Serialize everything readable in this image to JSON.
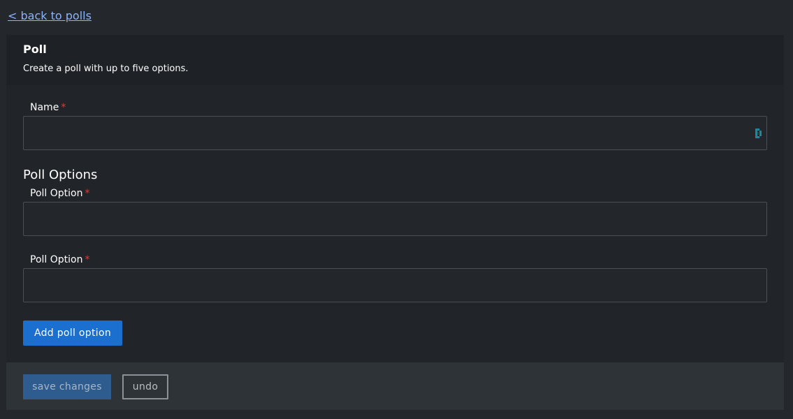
{
  "nav": {
    "back_link": "< back to polls"
  },
  "card": {
    "title": "Poll",
    "subtitle": "Create a poll with up to five options."
  },
  "form": {
    "name_label": "Name",
    "name_value": "",
    "required_marker": "*",
    "options_heading": "Poll Options",
    "options": [
      {
        "label": "Poll Option",
        "value": ""
      },
      {
        "label": "Poll Option",
        "value": ""
      }
    ],
    "add_option_label": "Add poll option"
  },
  "footer": {
    "save_label": "save changes",
    "undo_label": "undo"
  },
  "colors": {
    "accent": "#1b6fcf",
    "required": "#e53935",
    "link": "#8ab4f8",
    "password_manager_icon": "#1a8a9a"
  },
  "icons": {
    "name_field_icon": "password-manager-icon"
  }
}
